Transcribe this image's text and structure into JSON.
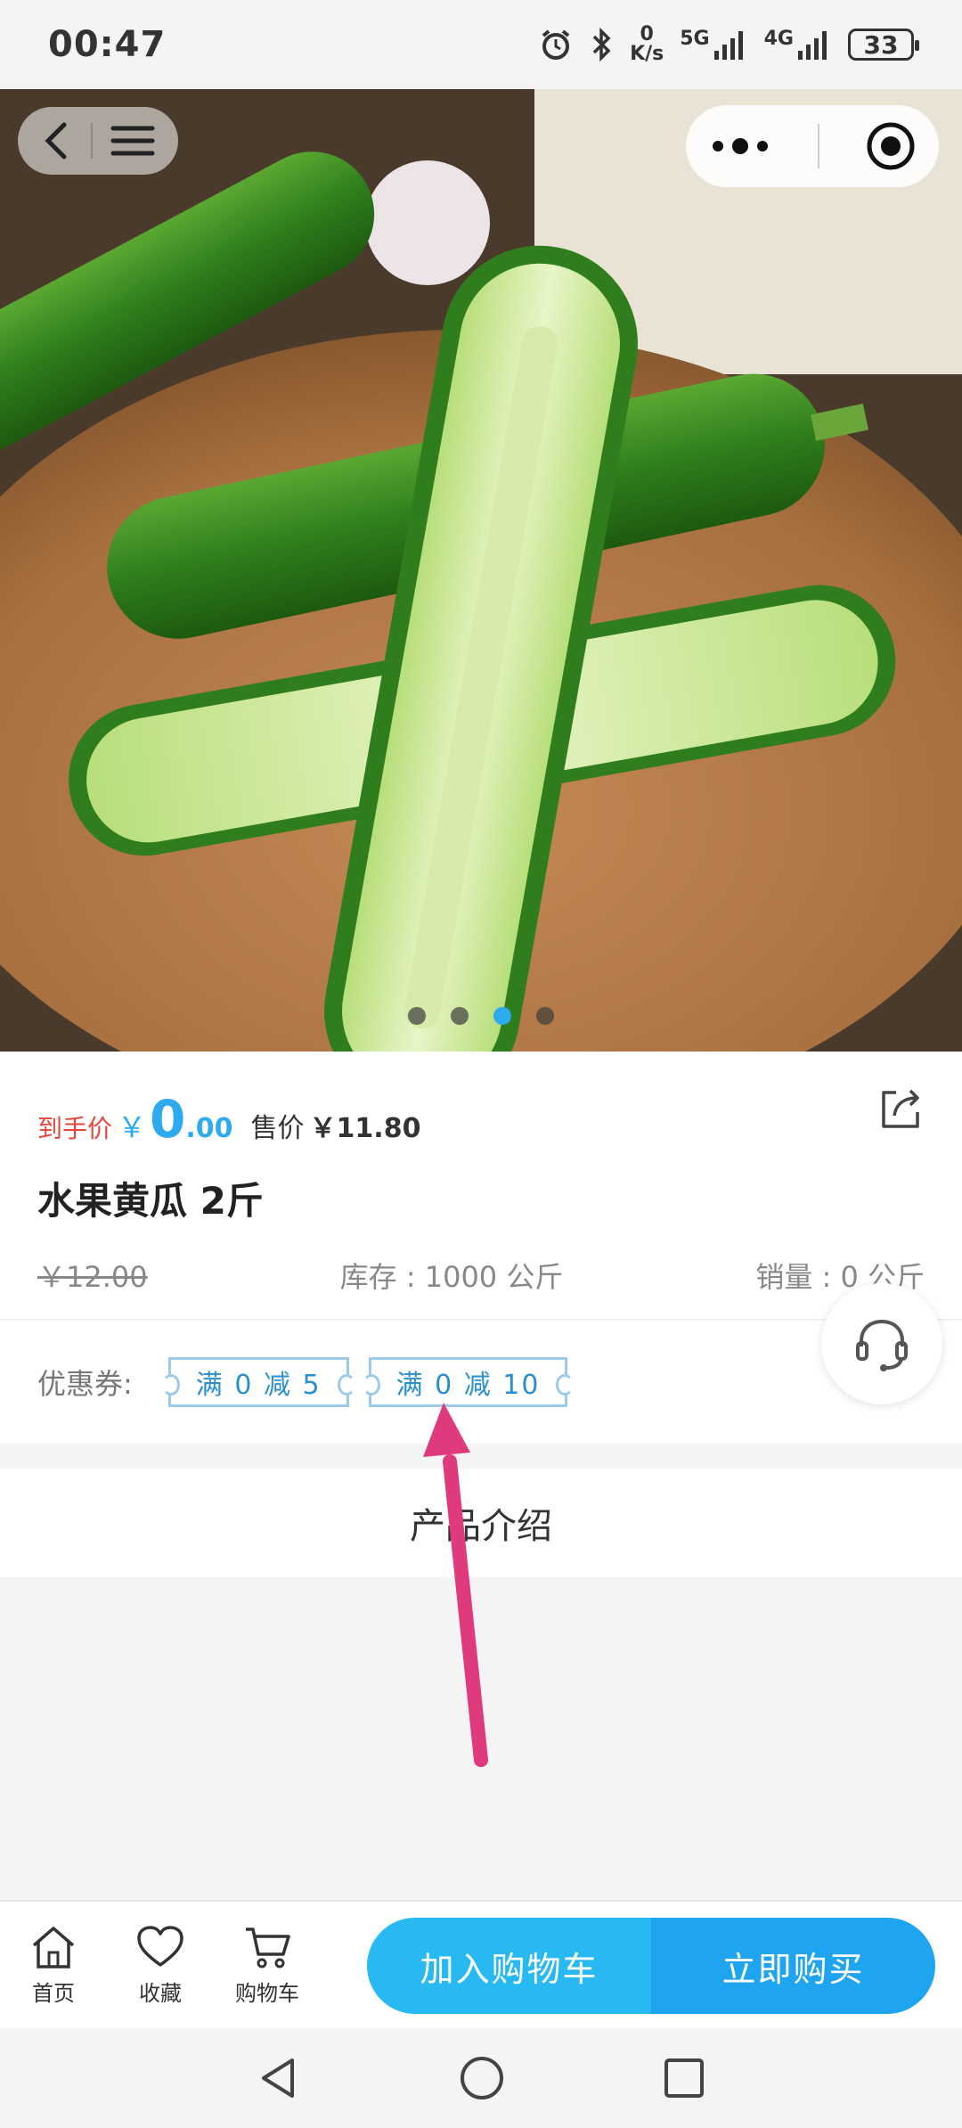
{
  "status_bar": {
    "time": "00:47",
    "net_speed_top": "0",
    "net_speed_unit": "K/s",
    "sig1": "5G",
    "sig2": "4G",
    "battery": "33"
  },
  "carousel": {
    "slide_count": 4,
    "active_index": 2
  },
  "product": {
    "deal_label": "到手价",
    "deal_yen": "￥",
    "deal_int": "0",
    "deal_dec": ".00",
    "sale_label": "售价",
    "sale_price": "￥11.80",
    "title": "水果黄瓜 2斤",
    "original_price": "￥12.00",
    "stock": "库存 : 1000 公斤",
    "sales": "销量 : 0 公斤"
  },
  "coupons": {
    "label": "优惠券:",
    "items": [
      "满 0 减 5",
      "满 0 减 10"
    ]
  },
  "intro": {
    "title": "产品介绍"
  },
  "bottom_bar": {
    "tabs": [
      "首页",
      "收藏",
      "购物车"
    ],
    "add_to_cart": "加入购物车",
    "buy_now": "立即购买"
  },
  "colors": {
    "accent": "#2eaaf0",
    "deal_red": "#e5453a",
    "arrow": "#e03a7e"
  }
}
